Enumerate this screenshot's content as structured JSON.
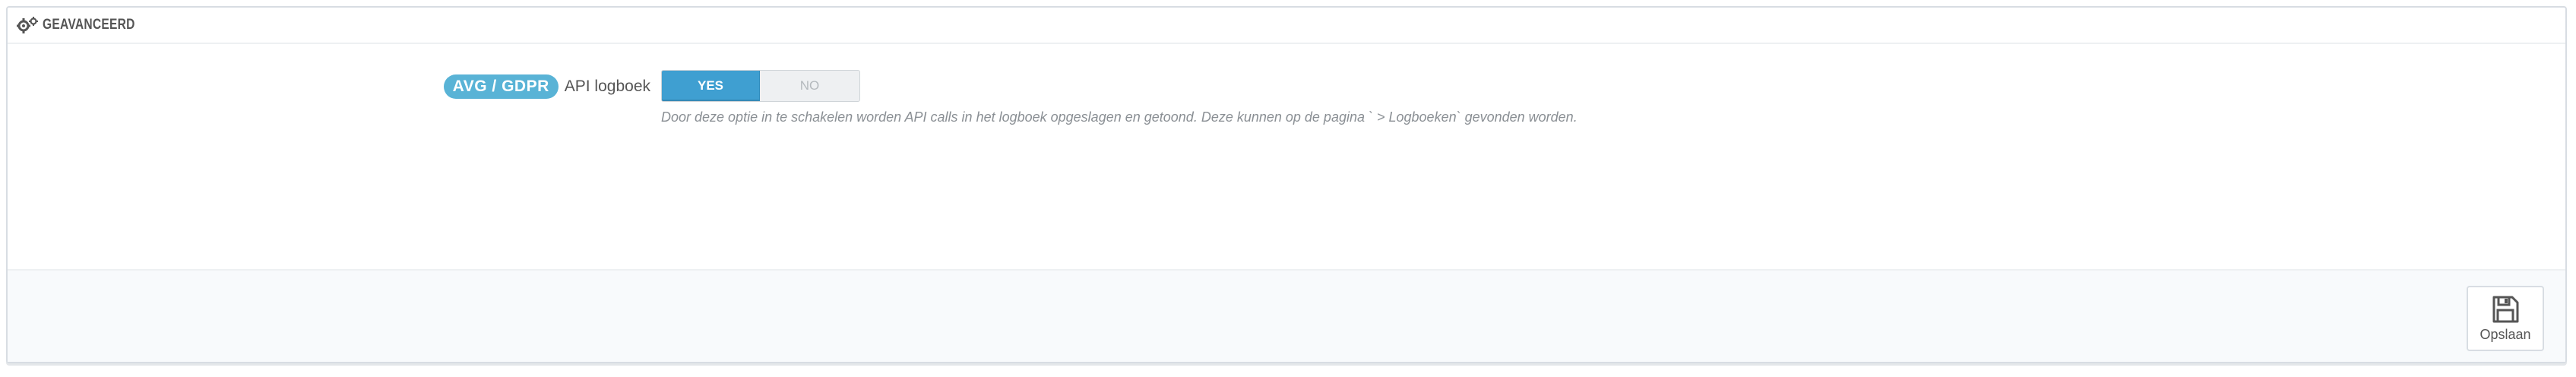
{
  "panel": {
    "title": "GEAVANCEERD",
    "title_icon": "gears-icon"
  },
  "field": {
    "badge": "AVG / GDPR",
    "label": "API logboek",
    "toggle": {
      "yes_label": "YES",
      "no_label": "NO",
      "selected": "YES"
    },
    "help": "Door deze optie in te schakelen worden API calls in het logboek opgeslagen en getoond. Deze kunnen op de pagina ` > Logboeken` gevonden worden."
  },
  "footer": {
    "save_label": "Opslaan",
    "save_icon": "save-icon"
  },
  "colors": {
    "accent": "#3f9fd1",
    "badge": "#59b3d6",
    "footer_bg": "#f8fafc"
  }
}
